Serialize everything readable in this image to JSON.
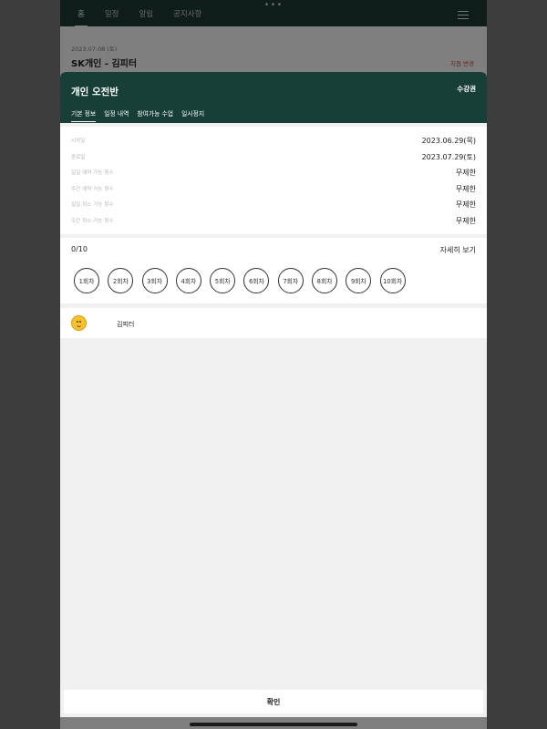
{
  "app": {
    "more_dots": "•••",
    "tabs": [
      "홈",
      "일정",
      "알림",
      "공지사항"
    ],
    "date": "2023.07.08 (토)",
    "title": "SK개인 - 김피터",
    "change_link": "지점 변경"
  },
  "modal": {
    "title": "개인 오전반",
    "ticket_label": "수강권",
    "tabs": [
      "기본 정보",
      "일정 내역",
      "참여가능 수업",
      "일시정지"
    ],
    "info": [
      {
        "label": "시작일",
        "value": "2023.06.29(목)"
      },
      {
        "label": "종료일",
        "value": "2023.07.29(토)"
      },
      {
        "label": "일일 예약 가능 횟수",
        "value": "무제한"
      },
      {
        "label": "주간 예약 가능 횟수",
        "value": "무제한"
      },
      {
        "label": "일일 취소 가능 횟수",
        "value": "무제한"
      },
      {
        "label": "주간 취소 가능 횟수",
        "value": "무제한"
      }
    ],
    "session_count": "0/10",
    "detail_link": "자세히 보기",
    "sessions": [
      "1회차",
      "2회차",
      "3회차",
      "4회차",
      "5회차",
      "6회차",
      "7회차",
      "8회차",
      "9회차",
      "10회차"
    ],
    "member_name": "김피터",
    "confirm_label": "확인"
  },
  "colors": {
    "header_bg": "#173f38",
    "nav_bg": "#1f3a34",
    "accent_red": "#d0453f"
  }
}
